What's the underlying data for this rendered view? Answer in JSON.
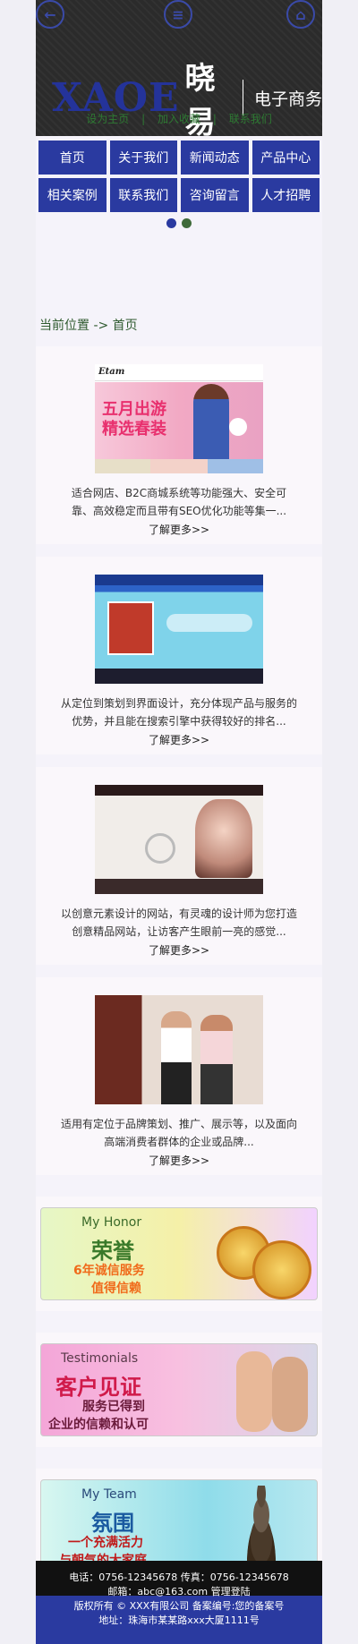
{
  "header": {
    "brand_en": "XAOE",
    "brand_cn": "晓易",
    "tagline": "电子商务",
    "links": [
      "设为主页",
      "|",
      "加入收藏",
      "|",
      "联系我们"
    ],
    "icon_back": "back-arrow-icon",
    "icon_menu": "menu-icon",
    "icon_home": "home-icon"
  },
  "nav": {
    "items": [
      "首页",
      "关于我们",
      "新闻动态",
      "产品中心",
      "相关案例",
      "联系我们",
      "咨询留言",
      "人才招聘"
    ]
  },
  "breadcrumb": "当前位置 -> 首页",
  "cases": [
    {
      "desc": "适合网店、B2C商城系统等功能强大、安全可靠、高效稳定而且带有SEO优化功能等集一...",
      "more": "了解更多>>",
      "thumb_text": "五月出游 精选春装"
    },
    {
      "desc": "从定位到策划到界面设计，充分体现产品与服务的优势，并且能在搜索引擎中获得较好的排名...",
      "more": "了解更多>>",
      "thumb_text": ""
    },
    {
      "desc": "以创意元素设计的网站，有灵魂的设计师为您打造创意精品网站，让访客产生眼前一亮的感觉...",
      "more": "了解更多>>",
      "thumb_text": ""
    },
    {
      "desc": "适用有定位于品牌策划、推广、展示等，以及面向高端消费者群体的企业或品牌...",
      "more": "了解更多>>",
      "thumb_text": ""
    }
  ],
  "banners": [
    {
      "en": "My Honor",
      "cn": "荣誉",
      "sub1": "6年诚信服务",
      "sub2": "值得信赖"
    },
    {
      "en": "Testimonials",
      "cn": "客户见证",
      "sub1": "服务已得到",
      "sub2": "企业的信赖和认可"
    },
    {
      "en": "My Team",
      "cn": "氛围",
      "sub1": "一个充满活力",
      "sub2": "与朝气的大家庭"
    }
  ],
  "footer": {
    "line1": "电话：0756-12345678      传真：0756-12345678",
    "line2": "邮箱：abc@163.com      管理登陆",
    "line3": "版权所有 © XXX有限公司   备案编号:您的备案号",
    "line4": "地址：珠海市某某路xxx大厦1111号"
  },
  "colors": {
    "accent": "#2a3aa0",
    "header_bg": "#2b2b2b",
    "link_green": "#2e7a33"
  }
}
